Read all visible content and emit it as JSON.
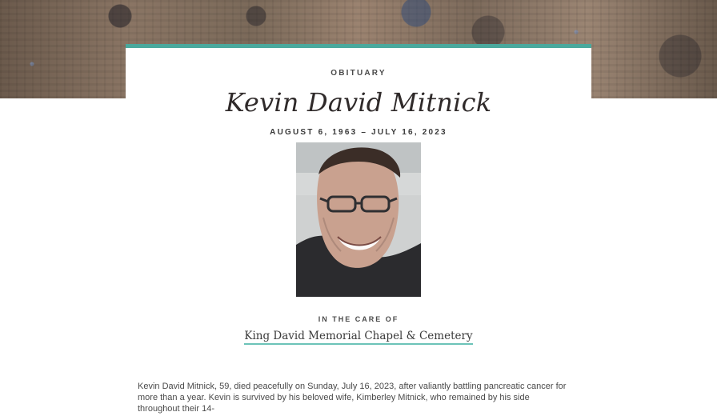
{
  "obituary": {
    "kicker": "OBITUARY",
    "name": "Kevin David Mitnick",
    "dates": "AUGUST 6, 1963 – JULY 16, 2023",
    "care": {
      "label": "IN THE CARE OF",
      "funeral_home": "King David Memorial Chapel & Cemetery"
    },
    "body_excerpt": "Kevin David Mitnick, 59, died peacefully on Sunday, July 16, 2023, after valiantly battling pancreatic cancer for more than a year. Kevin is survived by his beloved wife, Kimberley Mitnick, who remained by his side throughout their 14-"
  },
  "colors": {
    "accent": "#4aa99d",
    "link_underline": "#6cc3b8",
    "text_dark": "#2f2a2a"
  }
}
